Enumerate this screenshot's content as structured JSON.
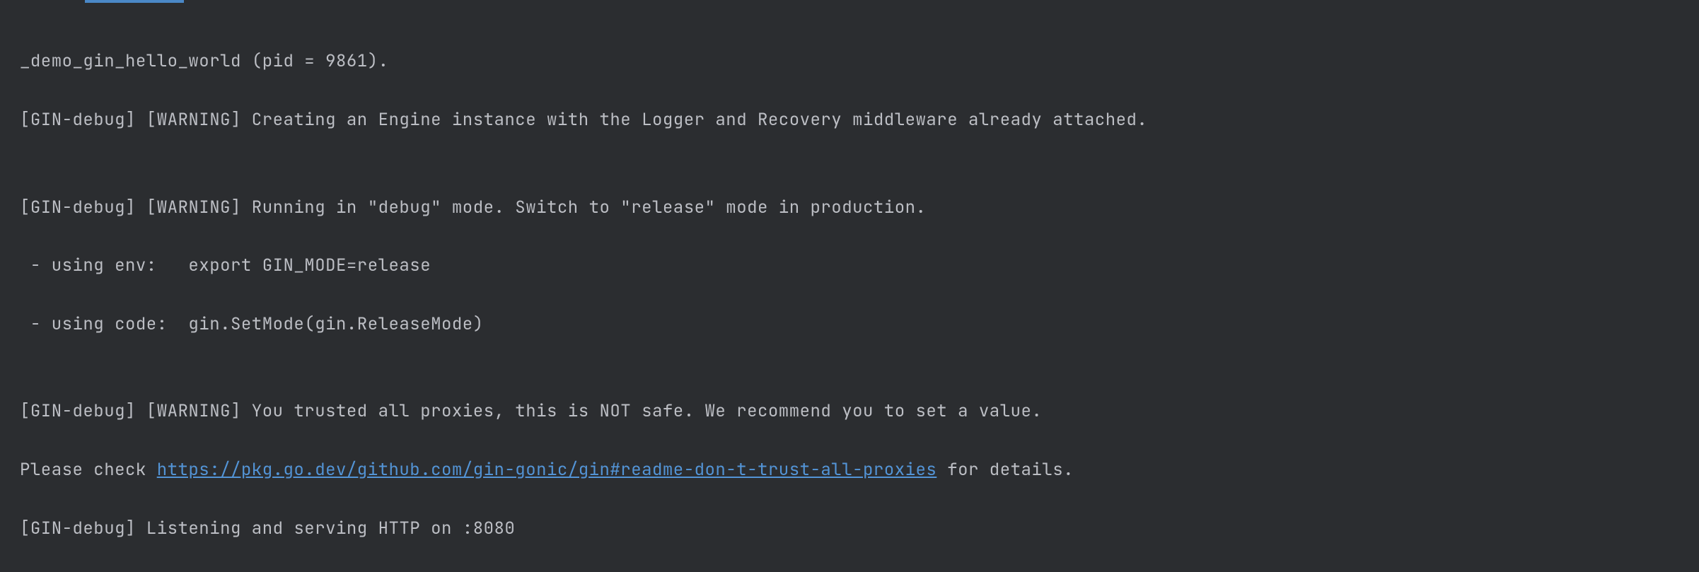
{
  "console": {
    "line1": "_demo_gin_hello_world (pid = 9861).",
    "line2": "[GIN-debug] [WARNING] Creating an Engine instance with the Logger and Recovery middleware already attached.",
    "line3": "",
    "line4": "[GIN-debug] [WARNING] Running in \"debug\" mode. Switch to \"release\" mode in production.",
    "line5": " - using env:   export GIN_MODE=release",
    "line6": " - using code:  gin.SetMode(gin.ReleaseMode)",
    "line7": "",
    "line8": "[GIN-debug] [WARNING] You trusted all proxies, this is NOT safe. We recommend you to set a value.",
    "line9_prefix": "Please check ",
    "line9_link": "https://pkg.go.dev/github.com/gin-gonic/gin#readme-don-t-trust-all-proxies",
    "line9_suffix": " for details.",
    "line10": "[GIN-debug] Listening and serving HTTP on :8080"
  },
  "gutter": {
    "marker": ""
  }
}
